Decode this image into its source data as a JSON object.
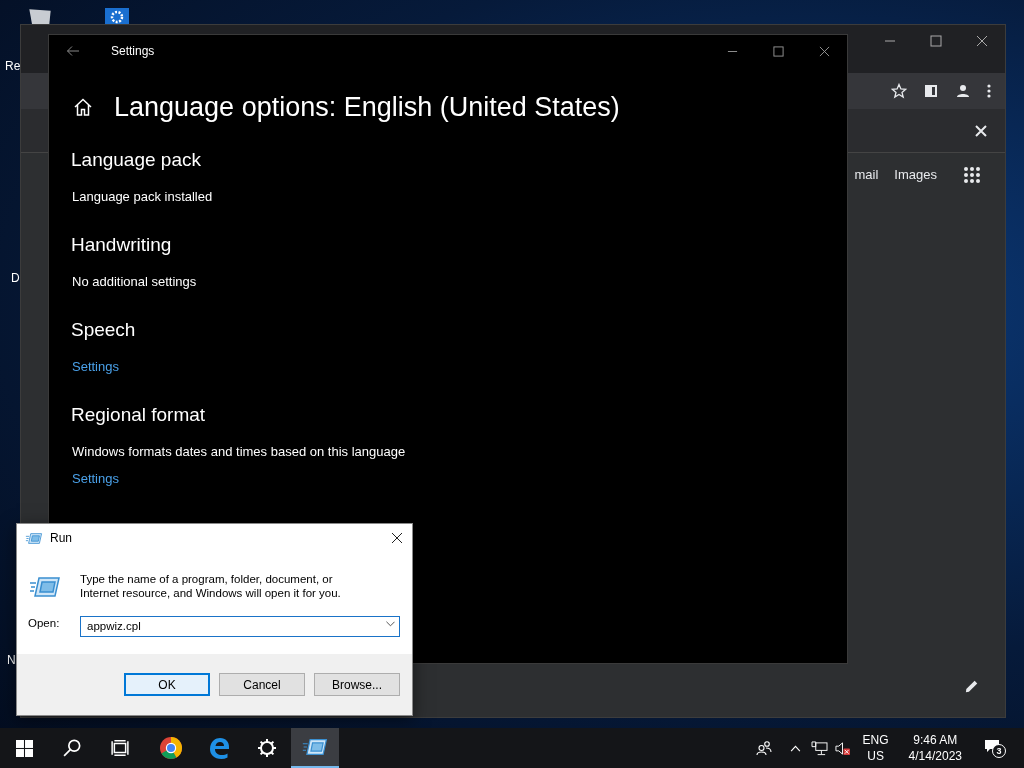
{
  "desktop": {
    "labels": [
      "Re",
      "D",
      "N"
    ]
  },
  "browser": {
    "links": [
      "mail",
      "Images"
    ]
  },
  "settings": {
    "title": "Settings",
    "heading": "Language options: English (United States)",
    "sections": [
      {
        "title": "Language pack",
        "items": [
          {
            "kind": "text",
            "text": "Language pack installed"
          }
        ]
      },
      {
        "title": "Handwriting",
        "items": [
          {
            "kind": "text",
            "text": "No additional settings"
          }
        ]
      },
      {
        "title": "Speech",
        "items": [
          {
            "kind": "link",
            "text": "Settings"
          }
        ]
      },
      {
        "title": "Regional format",
        "items": [
          {
            "kind": "text",
            "text": "Windows formats dates and times based on this language"
          },
          {
            "kind": "link",
            "text": "Settings"
          }
        ]
      }
    ]
  },
  "run": {
    "title": "Run",
    "description": "Type the name of a program, folder, document, or Internet resource, and Windows will open it for you.",
    "open_label": "Open:",
    "value": "appwiz.cpl",
    "buttons": [
      {
        "label": "OK",
        "default": true
      },
      {
        "label": "Cancel",
        "default": false
      },
      {
        "label": "Browse...",
        "default": false
      }
    ]
  },
  "taskbar": {
    "apps": [
      {
        "kind": "start",
        "selected": false
      },
      {
        "kind": "search",
        "selected": false
      },
      {
        "kind": "taskview",
        "selected": false
      },
      {
        "kind": "chrome",
        "selected": false
      },
      {
        "kind": "edge",
        "selected": false
      },
      {
        "kind": "settings",
        "selected": false
      },
      {
        "kind": "run",
        "selected": true
      }
    ],
    "language": "ENG",
    "region": "US",
    "time": "9:46 AM",
    "date": "4/14/2023",
    "notifications": "3"
  }
}
